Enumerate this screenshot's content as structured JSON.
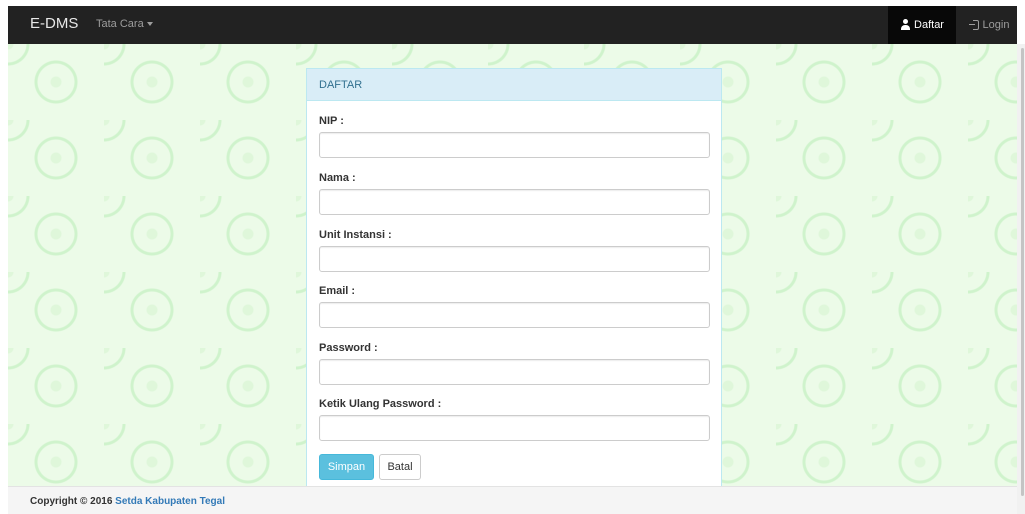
{
  "navbar": {
    "brand": "E-DMS",
    "menu_tata_cara": "Tata Cara",
    "daftar_label": "Daftar",
    "login_label": "Login",
    "daftar_icon": "user-icon",
    "login_icon": "login-icon"
  },
  "panel": {
    "heading": "DAFTAR",
    "fields": [
      {
        "label": "NIP :",
        "value": ""
      },
      {
        "label": "Nama :",
        "value": ""
      },
      {
        "label": "Unit Instansi :",
        "value": ""
      },
      {
        "label": "Email :",
        "value": ""
      },
      {
        "label": "Password :",
        "value": ""
      },
      {
        "label": "Ketik Ulang Password :",
        "value": ""
      }
    ],
    "submit_label": "Simpan",
    "cancel_label": "Batal"
  },
  "footer": {
    "copyright": "Copyright © 2016",
    "link_text": "Setda Kabupaten Tegal"
  },
  "colors": {
    "navbar_bg": "#222222",
    "panel_heading_bg": "#d9edf7",
    "panel_heading_text": "#31708f",
    "submit_bg": "#5bc0de",
    "link": "#337ab7",
    "background_pattern": "#ecfbe8"
  }
}
